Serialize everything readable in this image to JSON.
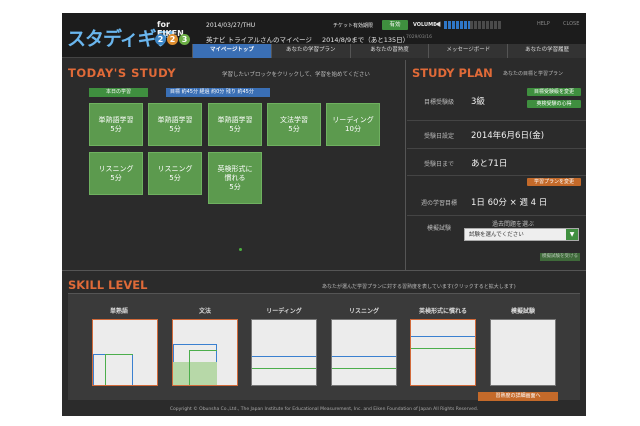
{
  "header": {
    "logo_text": "スタディギア",
    "logo_for": "for EIKEN",
    "logo_levels": [
      "2",
      "2",
      "3"
    ],
    "date_line": "2014/03/27/THU",
    "ticket_label": "チケット有効期限",
    "ticket_badge": "有効",
    "volume_label": "VOLUME",
    "user_line": "英ナビ トライアルさんのマイページ",
    "until_line": "2014/8/9まで（あと135日）",
    "small_info": "7029/03/16",
    "help_label": "HELP",
    "close_label": "CLOSE",
    "colors": {
      "accent": "#3a6fb5",
      "green": "#3f8f3f",
      "orange": "#e06a38"
    }
  },
  "tabs": [
    {
      "label": "マイページトップ",
      "active": true
    },
    {
      "label": "あなたの学習プラン",
      "active": false
    },
    {
      "label": "あなたの習熟度",
      "active": false
    },
    {
      "label": "メッセージボード",
      "active": false
    },
    {
      "label": "あなたの学習履歴",
      "active": false
    }
  ],
  "today": {
    "title": "TODAY'S STUDY",
    "hint": "学習したいブロックをクリックして、学習を始めてください",
    "badge": "本日の学習",
    "info": "目標 約45分  経過 約0分  残り 約45分",
    "tasks": [
      {
        "name": "単熟語学習",
        "time": "5分"
      },
      {
        "name": "単熟語学習",
        "time": "5分"
      },
      {
        "name": "単熟語学習",
        "time": "5分"
      },
      {
        "name": "文法学習",
        "time": "5分"
      },
      {
        "name": "リーディング",
        "time": "10分"
      },
      {
        "name": "リスニング",
        "time": "5分"
      },
      {
        "name": "リスニング",
        "time": "5分"
      },
      {
        "name": "英検形式に慣れる",
        "time": "5分"
      }
    ]
  },
  "plan": {
    "title": "STUDY PLAN",
    "subtitle": "あなたの目標と学習プラン",
    "grade_label": "目標受験級",
    "grade_value": "3級",
    "change_grade_btn": "目標受験級を変更",
    "exam_tips_btn": "英検受験の心得",
    "exam_date_label": "受験日設定",
    "exam_date_value": "2014年6月6日(金)",
    "days_label": "受験日まで",
    "days_value": "あと71日",
    "change_plan_btn": "学習プランを変更",
    "goal_label": "週の学習目標",
    "goal_value": "1日 60分 × 週 4 日",
    "mock_label": "模擬試験",
    "mock_hint": "過去問題を選ぶ",
    "mock_select": "試験を選んでください",
    "mock_start_btn": "模擬試験を受ける"
  },
  "skill": {
    "title": "SKILL LEVEL",
    "hint": "あなたが選んだ学習プランに対する習熟度を表しています(クリックすると拡大します)",
    "categories": [
      {
        "label": "単熟語",
        "level": 0.1
      },
      {
        "label": "文法",
        "level": 0.25
      },
      {
        "label": "リーディング",
        "level": 0.0
      },
      {
        "label": "リスニング",
        "level": 0.0
      },
      {
        "label": "英検形式に慣れる",
        "level": 0.0
      },
      {
        "label": "模擬試験",
        "level": 0.0
      }
    ],
    "detail_btn": "習熟度の詳細画面へ"
  },
  "footer": "Copyright © Obunsha Co.,Ltd., The Japan Institute for Educational Measurement, Inc. and Eiken Foundation of Japan All Rights Reserved."
}
